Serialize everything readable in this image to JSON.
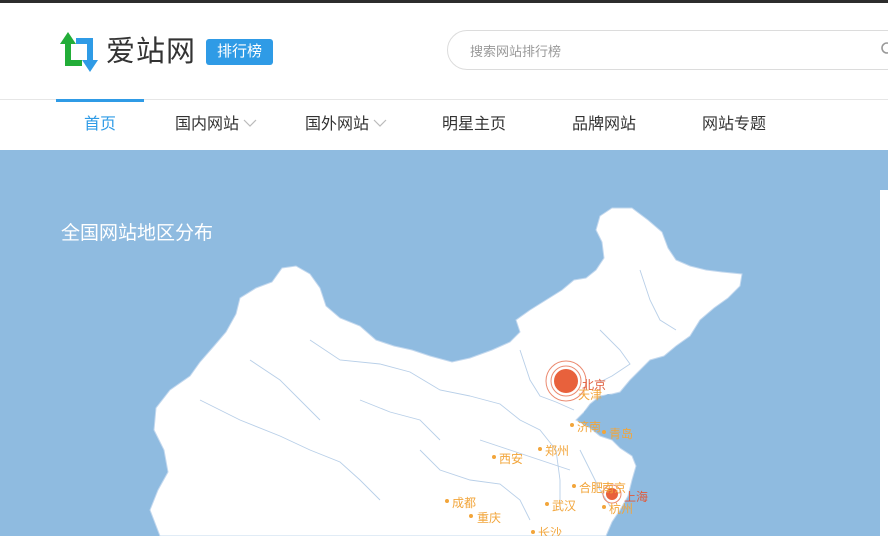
{
  "brand": {
    "name": "爱站网",
    "badge": "排行榜",
    "colors": {
      "accent": "#2f9be6",
      "logo_green": "#22ad38",
      "logo_blue": "#2f9be6"
    }
  },
  "search": {
    "placeholder": "搜索网站排行榜",
    "value": ""
  },
  "nav": {
    "items": [
      {
        "label": "首页",
        "active": true
      },
      {
        "label": "国内网站",
        "dropdown": true
      },
      {
        "label": "国外网站",
        "dropdown": true
      },
      {
        "label": "明星主页"
      },
      {
        "label": "品牌网站"
      },
      {
        "label": "网站专题"
      }
    ]
  },
  "map": {
    "title": "全国网站地区分布",
    "colors": {
      "sea": "#8fbbe0",
      "land": "#ffffff",
      "border": "#a9c6e6",
      "hotspot": "#e8613c",
      "city_label": "#f2a53a"
    },
    "cities": [
      {
        "name": "北京",
        "hotspot": true
      },
      {
        "name": "天津"
      },
      {
        "name": "济南"
      },
      {
        "name": "青岛"
      },
      {
        "name": "郑州"
      },
      {
        "name": "西安"
      },
      {
        "name": "合肥"
      },
      {
        "name": "南京"
      },
      {
        "name": "上海",
        "hotspot": true
      },
      {
        "name": "杭州"
      },
      {
        "name": "武汉"
      },
      {
        "name": "成都"
      },
      {
        "name": "重庆"
      },
      {
        "name": "长沙"
      }
    ]
  }
}
